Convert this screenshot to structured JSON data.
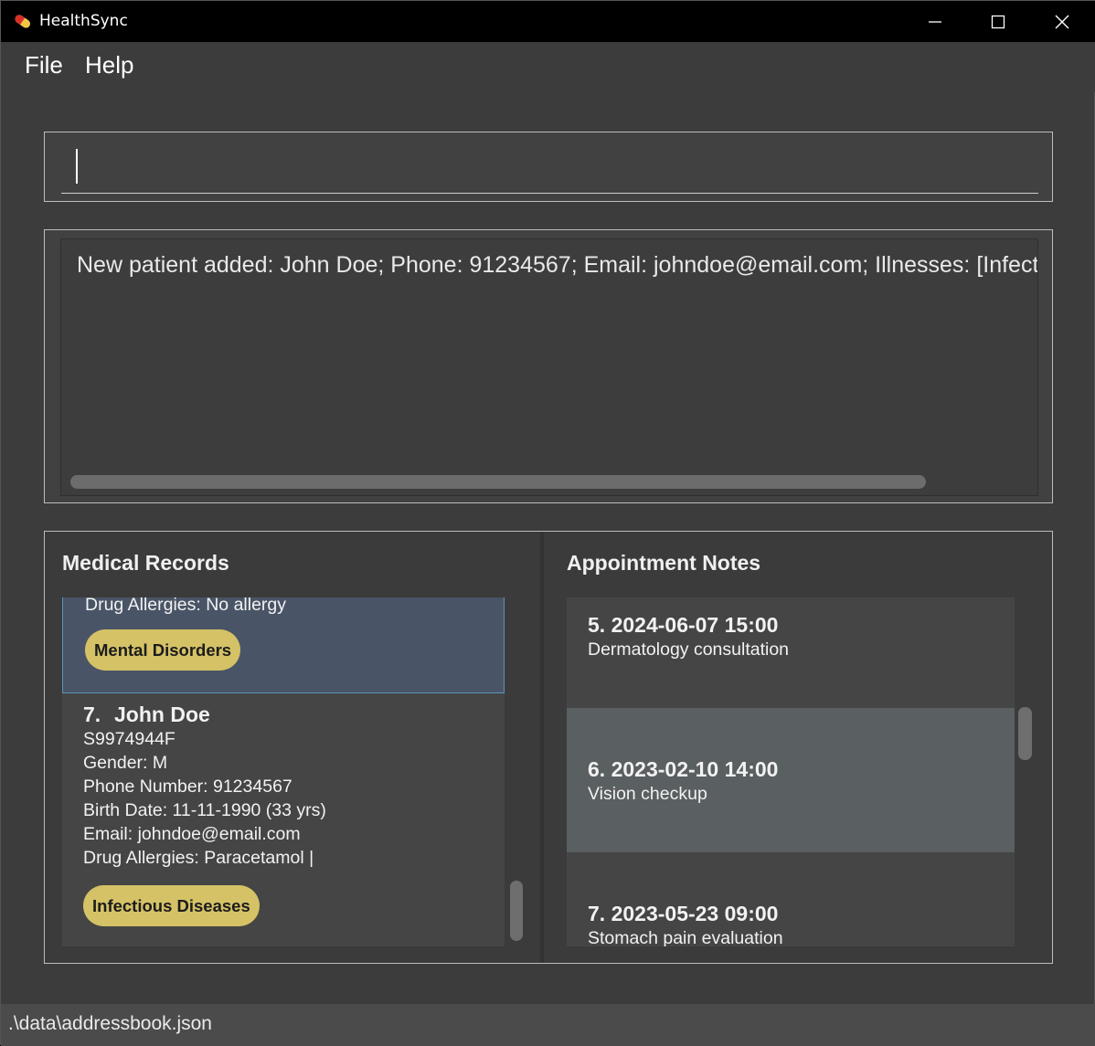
{
  "window": {
    "title": "HealthSync",
    "icon": "pill-capsule-icon"
  },
  "menu": {
    "file": "File",
    "help": "Help"
  },
  "command": {
    "value": "",
    "placeholder": ""
  },
  "result": {
    "text": "New patient added: John Doe; Phone: 91234567; Email: johndoe@email.com; Illnesses: [Infectious Diseases]"
  },
  "medical_records": {
    "title": "Medical Records",
    "partial_card": {
      "drug_allergies": "Drug Allergies: No allergy",
      "tag": "Mental Disorders"
    },
    "card": {
      "index": "7.",
      "name": "John Doe",
      "nric": "S9974944F",
      "gender": "Gender: M",
      "phone": "Phone Number: 91234567",
      "birth_date": "Birth Date: 11-11-1990 (33 yrs)",
      "email": "Email: johndoe@email.com",
      "drug_allergies": "Drug Allergies: Paracetamol |",
      "tag": "Infectious Diseases"
    }
  },
  "appointment_notes": {
    "title": "Appointment Notes",
    "items": [
      {
        "title": "5.  2024-06-07 15:00",
        "description": "Dermatology consultation"
      },
      {
        "title": "6.  2023-02-10 14:00",
        "description": "Vision checkup"
      },
      {
        "title": "7.  2023-05-23 09:00",
        "description": "Stomach pain evaluation"
      }
    ]
  },
  "status": {
    "file_path": ".\\data\\addressbook.json"
  },
  "colors": {
    "background": "#3c3c3c",
    "title_bar": "#000000",
    "selected_card": "#495566",
    "selected_border": "#5d93b9",
    "tag": "#d5c266",
    "highlighted_appointment": "#5a5f61"
  }
}
